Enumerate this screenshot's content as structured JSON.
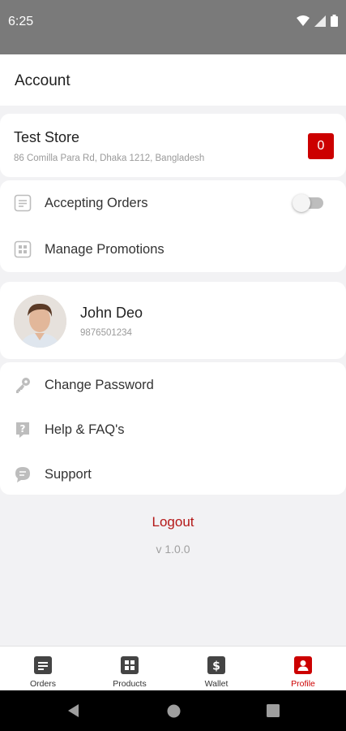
{
  "status_bar": {
    "time": "6:25"
  },
  "header": {
    "title": "Account"
  },
  "store": {
    "name": "Test Store",
    "address": "86 Comilla Para Rd, Dhaka 1212, Bangladesh",
    "badge_count": "0"
  },
  "store_menu": [
    {
      "label": "Accepting Orders",
      "icon": "list-icon",
      "toggle": false
    },
    {
      "label": "Manage Promotions",
      "icon": "grid-icon"
    }
  ],
  "profile": {
    "name": "John Deo",
    "phone": "9876501234"
  },
  "account_menu": [
    {
      "label": "Change Password",
      "icon": "key-icon"
    },
    {
      "label": "Help & FAQ's",
      "icon": "help-icon"
    },
    {
      "label": "Support",
      "icon": "chat-icon"
    }
  ],
  "logout_label": "Logout",
  "version": "v 1.0.0",
  "bottom_nav": [
    {
      "label": "Orders",
      "icon": "orders-icon",
      "active": false
    },
    {
      "label": "Products",
      "icon": "products-icon",
      "active": false
    },
    {
      "label": "Wallet",
      "icon": "wallet-icon",
      "active": false
    },
    {
      "label": "Profile",
      "icon": "profile-icon",
      "active": true
    }
  ],
  "colors": {
    "accent": "#cc0000",
    "status_bar": "#7a7a7a",
    "background": "#f2f2f4",
    "nav_icon": "#444444"
  }
}
